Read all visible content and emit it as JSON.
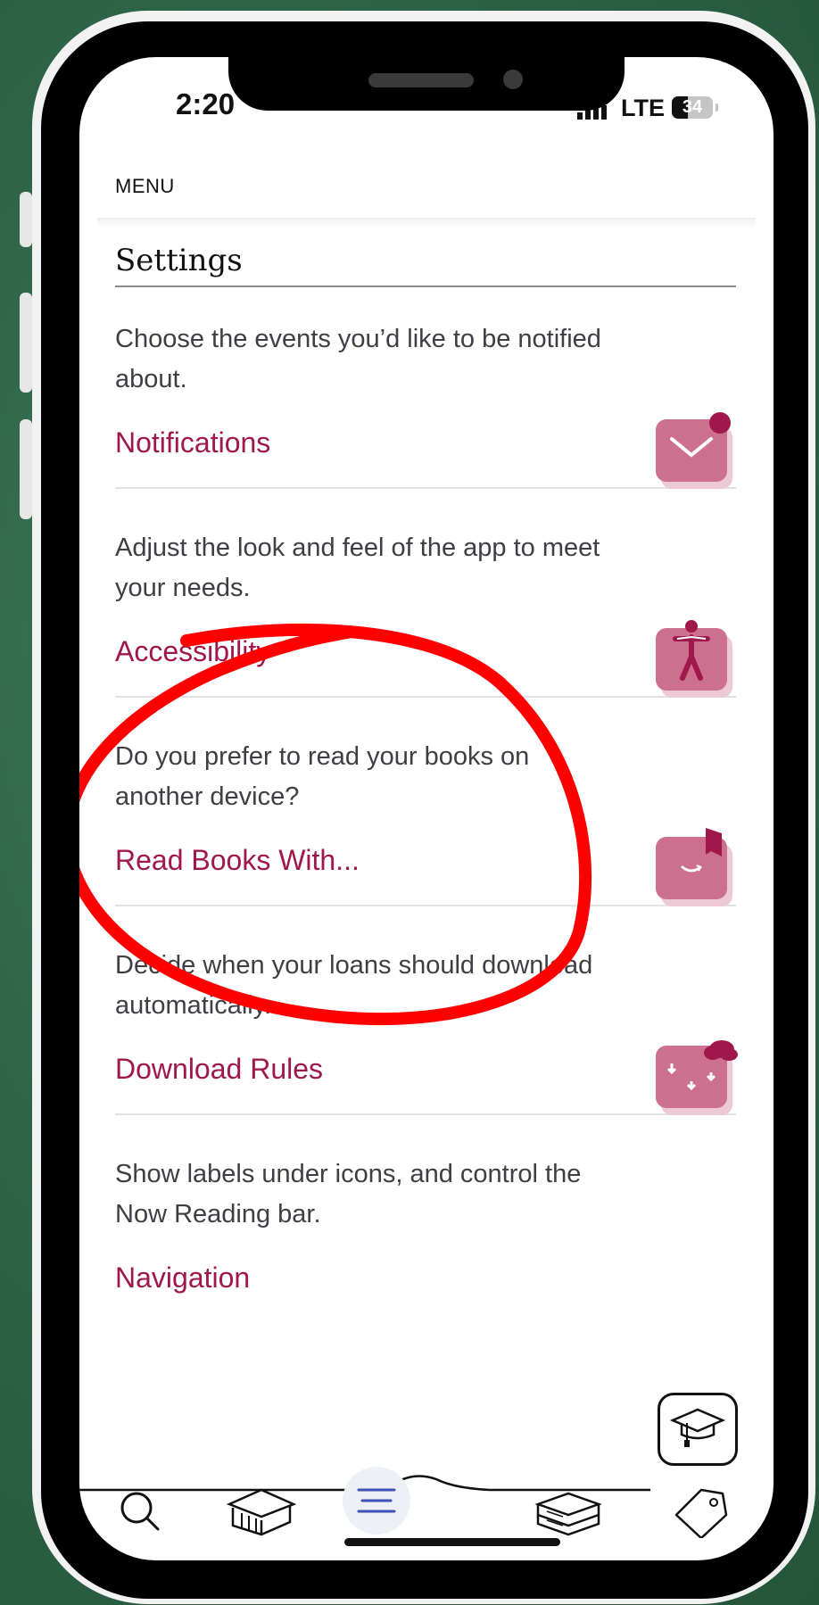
{
  "status_bar": {
    "time": "2:20",
    "network": "LTE",
    "battery": "34"
  },
  "header": {
    "menu_label": "MENU",
    "title": "Settings"
  },
  "settings_items": [
    {
      "description": "Choose the events you’d like to be notified about.",
      "link": "Notifications",
      "icon": "envelope-icon"
    },
    {
      "description": "Adjust the look and feel of the app to meet your needs.",
      "link": "Accessibility",
      "icon": "accessibility-person-icon"
    },
    {
      "description": "Do you prefer to read your books on another device?",
      "link": "Read Books With...",
      "icon": "amazon-box-icon"
    },
    {
      "description": "Decide when your loans should download automatically.",
      "link": "Download Rules",
      "icon": "cloud-download-icon"
    },
    {
      "description": "Show labels under icons, and control the Now Reading bar.",
      "link": "Navigation",
      "icon": "navigation-icon"
    }
  ],
  "tab_bar": [
    {
      "icon": "search-icon"
    },
    {
      "icon": "library-building-icon"
    },
    {
      "icon": "menu-icon",
      "active": true
    },
    {
      "icon": "books-stack-icon"
    },
    {
      "icon": "tag-icon"
    }
  ],
  "colors": {
    "accent": "#a0184b",
    "icon_pink": "#cd6f8f",
    "annotation_red": "#ff0000",
    "active_tab": "#3f51b5"
  }
}
